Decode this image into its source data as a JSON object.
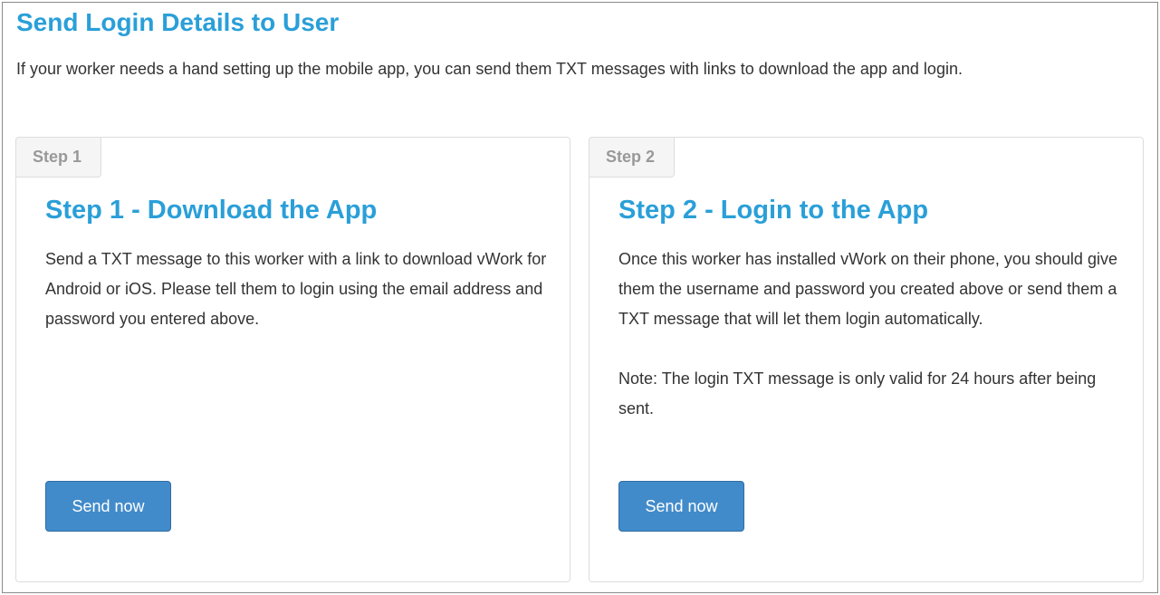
{
  "page": {
    "title": "Send Login Details to User",
    "intro": "If your worker needs a hand setting up the mobile app, you can send them TXT messages with links to download the app and login."
  },
  "steps": [
    {
      "tab_label": "Step 1",
      "heading": "Step 1 - Download the App",
      "paragraphs": [
        "Send a TXT message to this worker with a link to download vWork for Android or iOS. Please tell them to login using the email address and password you entered above."
      ],
      "button_label": "Send now"
    },
    {
      "tab_label": "Step 2",
      "heading": "Step 2 - Login to the App",
      "paragraphs": [
        "Once this worker has installed vWork on their phone, you should give them the username and password you created above or send them a TXT message that will let them login automatically.",
        "Note: The login TXT message is only valid for 24 hours after being sent."
      ],
      "button_label": "Send now"
    }
  ]
}
